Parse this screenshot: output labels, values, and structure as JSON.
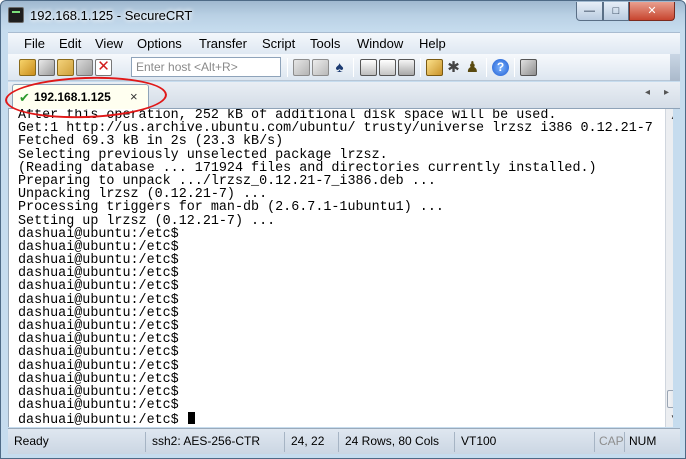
{
  "window": {
    "title": "192.168.1.125 - SecureCRT",
    "minimize_label": "—",
    "maximize_label": "□",
    "close_label": "✕"
  },
  "menu": [
    "File",
    "Edit",
    "View",
    "Options",
    "Transfer",
    "Script",
    "Tools",
    "Window",
    "Help"
  ],
  "toolbar": {
    "host_placeholder": "Enter host <Alt+R>"
  },
  "tabs": {
    "active": {
      "label": "192.168.1.125",
      "status_icon": "check-icon",
      "close_label": "×"
    },
    "scroll_left": "◂",
    "scroll_right": "▸"
  },
  "terminal": {
    "lines": [
      "After this operation, 252 kB of additional disk space will be used.",
      "Get:1 http://us.archive.ubuntu.com/ubuntu/ trusty/universe lrzsz i386 0.12.21-7",
      "Fetched 69.3 kB in 2s (23.3 kB/s)",
      "Selecting previously unselected package lrzsz.",
      "(Reading database ... 171924 files and directories currently installed.)",
      "Preparing to unpack .../lrzsz_0.12.21-7_i386.deb ...",
      "Unpacking lrzsz (0.12.21-7) ...",
      "Processing triggers for man-db (2.6.7.1-1ubuntu1) ...",
      "Setting up lrzsz (0.12.21-7) ...",
      "dashuai@ubuntu:/etc$",
      "dashuai@ubuntu:/etc$",
      "dashuai@ubuntu:/etc$",
      "dashuai@ubuntu:/etc$",
      "dashuai@ubuntu:/etc$",
      "dashuai@ubuntu:/etc$",
      "dashuai@ubuntu:/etc$",
      "dashuai@ubuntu:/etc$",
      "dashuai@ubuntu:/etc$",
      "dashuai@ubuntu:/etc$",
      "dashuai@ubuntu:/etc$",
      "dashuai@ubuntu:/etc$",
      "dashuai@ubuntu:/etc$",
      "dashuai@ubuntu:/etc$",
      "dashuai@ubuntu:/etc$ "
    ]
  },
  "status": {
    "state": "Ready",
    "cipher": "ssh2: AES-256-CTR",
    "cursor_pos": "24,  22",
    "dimensions": "24 Rows, 80 Cols",
    "emulation": "VT100",
    "caps": "CAP",
    "num": "NUM"
  },
  "colors": {
    "annotation": "#e01818",
    "tab_check": "#2d9a2d",
    "terminal_bg": "#ffffff"
  }
}
